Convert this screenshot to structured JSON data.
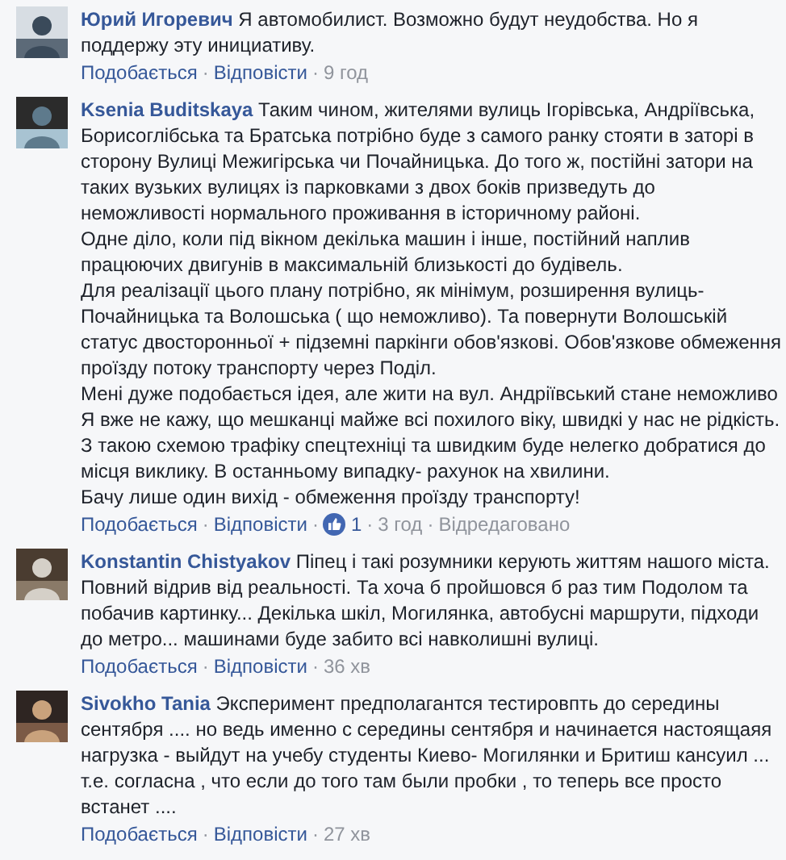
{
  "separator": "·",
  "comments": [
    {
      "author": "Юрий Игоревич",
      "paragraphs": [
        "Я автомобилист. Возможно будут неудобства. Но я поддержу эту инициативу."
      ],
      "actions": {
        "like": "Подобається",
        "reply": "Відповісти",
        "time": "9 год"
      }
    },
    {
      "author": "Ksenia Buditskaya",
      "paragraphs": [
        "Таким чином, жителями вулиць Ігорівська, Андріївська, Борисоглібська та Братська потрібно буде з самого ранку стояти в заторі в сторону Вулиці Межигірська чи Почайницька. До того ж, постійні затори на таких вузьких вулицях із парковками з двох боків призведуть до неможливості нормального проживання в історичному районі.",
        "Одне діло, коли під вікном декілька машин і інше, постійний наплив працюючих двигунів в максимальній близькості до будівель.",
        "Для реалізації цього плану потрібно, як мінімум, розширення вулиць- Почайницька та Волошська ( що неможливо). Та повернути Волошській статус двосторонньої + підземні паркінги обов'язкові. Обов'язкове обмеження проїзду потоку транспорту через Поділ.",
        "Мені дуже подобається ідея, але жити на вул. Андріївський стане неможливо",
        "Я вже не кажу, що мешканці майже всі похилого віку, швидкі у нас не рідкість.",
        "З такою схемою трафіку спецтехніці та швидким буде нелегко добратися до місця виклику. В останньому випадку- рахунок на хвилини.",
        "Бачу лише один вихід - обмеження проїзду транспорту!"
      ],
      "actions": {
        "like": "Подобається",
        "reply": "Відповісти",
        "reactions": "1",
        "time": "3 год",
        "edited": "Відредаговано"
      }
    },
    {
      "author": "Konstantin Chistyakov",
      "paragraphs": [
        "Піпец і такі розумники керують життям нашого міста. Повний відрив від реальності. Та хоча б пройшовся б раз тим Подолом та побачив картинку... Декілька шкіл, Могилянка, автобусні маршрути, підходи до метро... машинами буде забито всі навколишні вулиці."
      ],
      "actions": {
        "like": "Подобається",
        "reply": "Відповісти",
        "time": "36 хв"
      }
    },
    {
      "author": "Sivokho Tania",
      "paragraphs": [
        "Эксперимент предполагантся тестировпть до середины сентября .... но ведь именно с середины сентября и начинается настоящаяя нагрузка - выйдут на учебу студенты Киево- Могилянки и Бритиш кансуил ... т.е. согласна , что если до того там были пробки , то теперь все просто встанет ...."
      ],
      "actions": {
        "like": "Подобається",
        "reply": "Відповісти",
        "time": "27 хв"
      }
    }
  ]
}
